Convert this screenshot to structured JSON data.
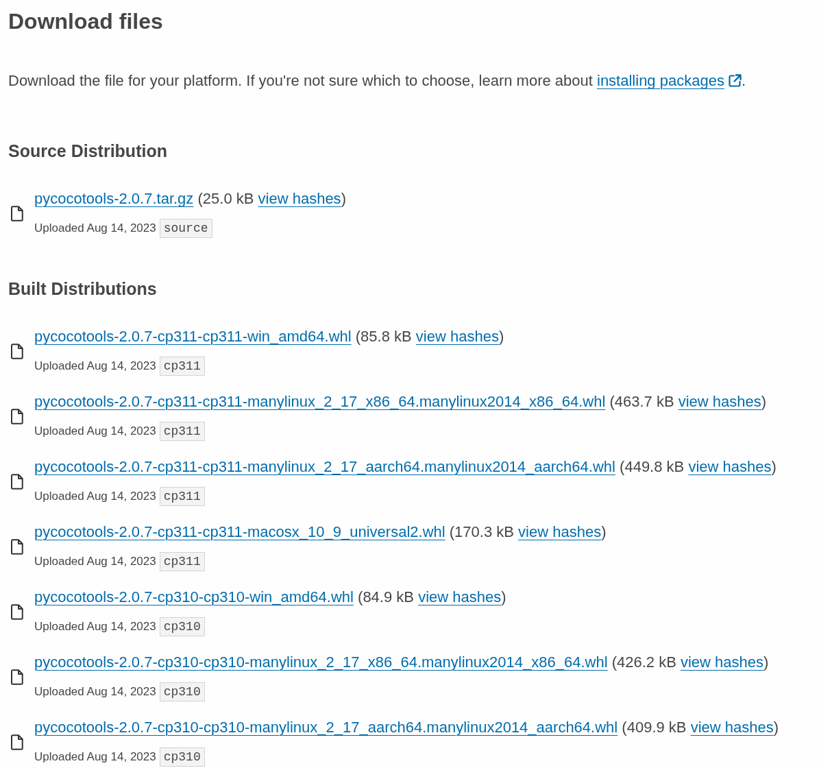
{
  "heading": "Download files",
  "intro": {
    "text": "Download the file for your platform. If you're not sure which to choose, learn more about",
    "link": "installing packages",
    "end": "."
  },
  "sections": [
    {
      "title": "Source Distribution",
      "files": [
        {
          "name": "pycocotools-2.0.7.tar.gz",
          "size": "(25.0 kB",
          "hashes": "view hashes",
          "close": ")",
          "uploaded": "Uploaded Aug 14, 2023",
          "tag": "source"
        }
      ]
    },
    {
      "title": "Built Distributions",
      "files": [
        {
          "name": "pycocotools-2.0.7-cp311-cp311-win_amd64.whl",
          "size": "(85.8 kB",
          "hashes": "view hashes",
          "close": ")",
          "uploaded": "Uploaded Aug 14, 2023",
          "tag": "cp311"
        },
        {
          "name": "pycocotools-2.0.7-cp311-cp311-manylinux_2_17_x86_64.manylinux2014_x86_64.whl",
          "size": "(463.7 kB",
          "hashes": "view hashes",
          "close": ")",
          "uploaded": "Uploaded Aug 14, 2023",
          "tag": "cp311"
        },
        {
          "name": "pycocotools-2.0.7-cp311-cp311-manylinux_2_17_aarch64.manylinux2014_aarch64.whl",
          "size": "(449.8 kB",
          "hashes": "view hashes",
          "close": ")",
          "uploaded": "Uploaded Aug 14, 2023",
          "tag": "cp311"
        },
        {
          "name": "pycocotools-2.0.7-cp311-cp311-macosx_10_9_universal2.whl",
          "size": "(170.3 kB",
          "hashes": "view hashes",
          "close": ")",
          "uploaded": "Uploaded Aug 14, 2023",
          "tag": "cp311"
        },
        {
          "name": "pycocotools-2.0.7-cp310-cp310-win_amd64.whl",
          "size": "(84.9 kB",
          "hashes": "view hashes",
          "close": ")",
          "uploaded": "Uploaded Aug 14, 2023",
          "tag": "cp310"
        },
        {
          "name": "pycocotools-2.0.7-cp310-cp310-manylinux_2_17_x86_64.manylinux2014_x86_64.whl",
          "size": "(426.2 kB",
          "hashes": "view hashes",
          "close": ")",
          "uploaded": "Uploaded Aug 14, 2023",
          "tag": "cp310"
        },
        {
          "name": "pycocotools-2.0.7-cp310-cp310-manylinux_2_17_aarch64.manylinux2014_aarch64.whl",
          "size": "(409.9 kB",
          "hashes": "view hashes",
          "close": ")",
          "uploaded": "Uploaded Aug 14, 2023",
          "tag": "cp310"
        }
      ]
    }
  ]
}
